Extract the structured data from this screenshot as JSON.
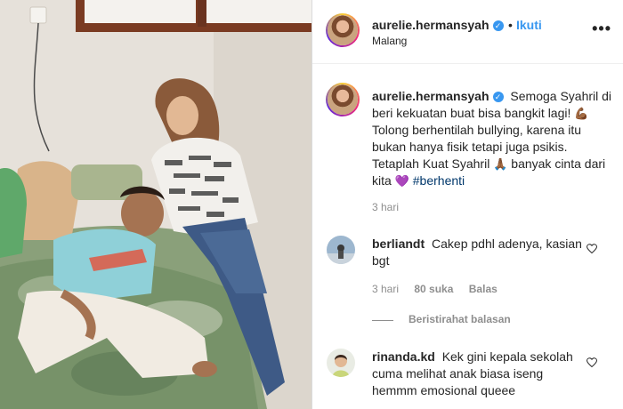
{
  "post": {
    "author": "aurelie.hermansyah",
    "follow_label": "Ikuti",
    "separator": "•",
    "location": "Malang",
    "more_label": "•••",
    "verified_mark": "✓"
  },
  "caption": {
    "username": "aurelie.hermansyah",
    "segments": {
      "part1": "Semoga Syahril di beri kekuatan buat bisa bangkit lagi! ",
      "emoji_flex": "💪🏾",
      "part2": " Tolong berhentilah bullying, karena itu bukan hanya fisik tetapi juga psikis. Tetaplah Kuat Syahril ",
      "emoji_pray": "🙏🏾",
      "part3": " banyak cinta dari kita ",
      "emoji_heart": "💜",
      "hashtag": "#berhenti"
    },
    "time": "3 hari"
  },
  "comments": [
    {
      "username": "berliandt",
      "text": "Cakep pdhl adenya, kasian bgt",
      "time": "3 hari",
      "likes": "80 suka",
      "reply_label": "Balas",
      "hidden_replies_label": "Beristirahat balasan"
    },
    {
      "username": "rinanda.kd",
      "text": "Kek gini kepala sekolah cuma melihat anak biasa iseng hemmm emosional queee"
    }
  ],
  "colors": {
    "link_blue": "#3897f0",
    "meta_gray": "#8e8e8e",
    "hashtag": "#00376b",
    "border": "#dbdbdb"
  },
  "icons": {
    "more": "more-options-icon",
    "heart": "heart-outline-icon",
    "verified": "verified-badge-icon"
  }
}
